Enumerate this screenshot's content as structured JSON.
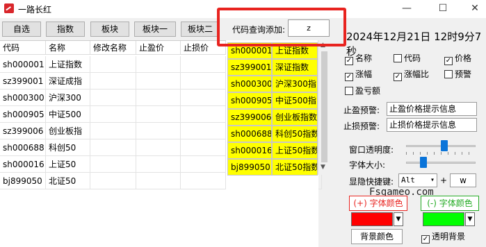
{
  "window": {
    "title": "一路长红",
    "min": "—",
    "max": "☐",
    "close": "✕"
  },
  "toolbar": [
    "自选",
    "指数",
    "板块",
    "板块一",
    "板块二"
  ],
  "grid": {
    "columns": [
      "代码",
      "名称",
      "修改名称",
      "止盈价",
      "止损价"
    ],
    "rows": [
      [
        "sh000001",
        "上证指数"
      ],
      [
        "sz399001",
        "深证成指"
      ],
      [
        "sh000300",
        "沪深300"
      ],
      [
        "sh000905",
        "中证500"
      ],
      [
        "sz399006",
        "创业板指"
      ],
      [
        "sh000688",
        "科创50"
      ],
      [
        "sh000016",
        "上证50"
      ],
      [
        "bj899050",
        "北证50"
      ]
    ]
  },
  "suggest": [
    [
      "sh000001",
      "上证指数"
    ],
    [
      "sz399001",
      "深证指数"
    ],
    [
      "sh000300",
      "沪深300指"
    ],
    [
      "sh000905",
      "中证500指"
    ],
    [
      "sz399006",
      "创业板指数"
    ],
    [
      "sh000688",
      "科创50指数"
    ],
    [
      "sh000016",
      "上证50指数"
    ],
    [
      "bj899050",
      "北证50指数"
    ]
  ],
  "query": {
    "label": "代码查询添加:",
    "value": "z"
  },
  "datetime": "2024年12月21日 12时9分7秒",
  "options": [
    {
      "label": "名称",
      "checked": true
    },
    {
      "label": "代码",
      "checked": false
    },
    {
      "label": "价格",
      "checked": true
    },
    {
      "label": "涨幅",
      "checked": true
    },
    {
      "label": "涨幅比",
      "checked": true
    },
    {
      "label": "预警",
      "checked": false
    },
    {
      "label": "盈亏额",
      "checked": false
    }
  ],
  "profit": {
    "label": "止盈预警:",
    "value": "止盈价格提示信息"
  },
  "loss": {
    "label": "止损预警:",
    "value": "止损价格提示信息"
  },
  "opacity": {
    "label": "窗口透明度:",
    "level": 0.55
  },
  "fontsize": {
    "label": "字体大小:",
    "level": 0.25
  },
  "hotkey": {
    "label": "显隐快捷键:",
    "modifier": "Alt",
    "plus": "+",
    "key": "w"
  },
  "watermark": "Fsgameo.com",
  "colors": {
    "up_label": "(+) 字体颜色",
    "up_color": "#ff0000",
    "up_text": "#e8231f",
    "down_label": "(-) 字体颜色",
    "down_color": "#00ff00",
    "down_text": "#22aa22",
    "bg_label": "背景颜色",
    "transparent_label": "透明背景",
    "transparent_checked": true
  }
}
